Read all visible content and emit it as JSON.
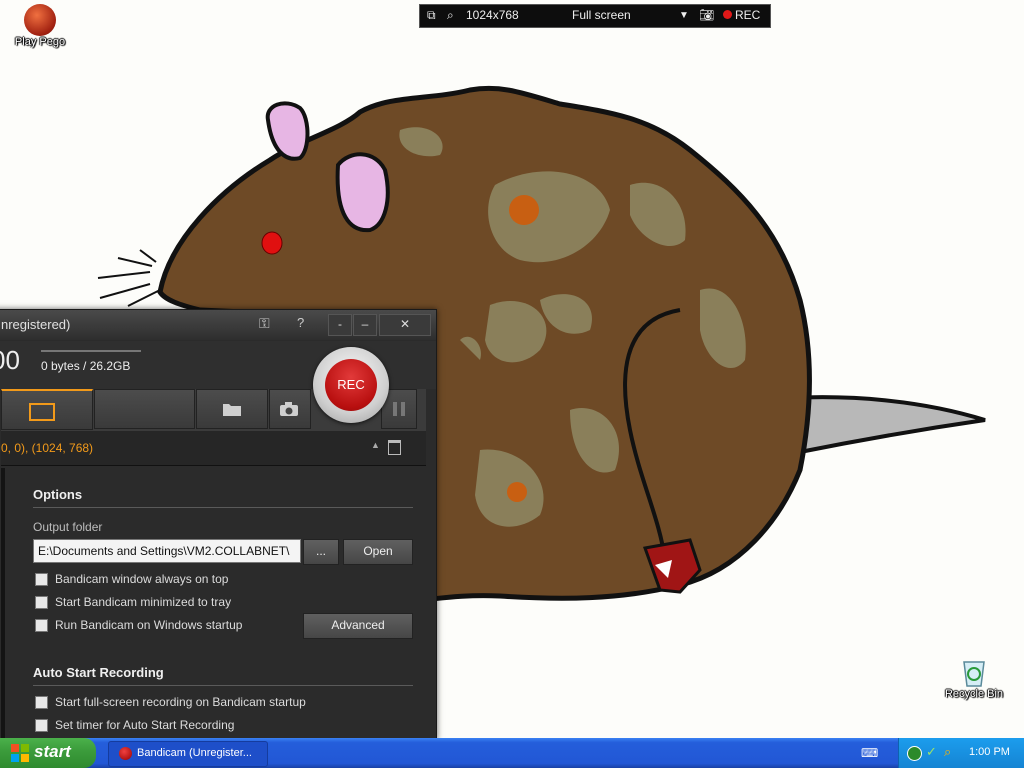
{
  "desktop": {
    "icons": [
      {
        "label": "Play Pego"
      },
      {
        "label": "Recycle Bin"
      }
    ]
  },
  "rec_toolbar": {
    "resolution": "1024x768",
    "mode": "Full screen",
    "rec_label": "REC",
    "icons": [
      "window-icon",
      "zoom-icon",
      "dropdown-icon",
      "camera-icon",
      "record-dot-icon"
    ]
  },
  "bandicam": {
    "title": "nregistered)",
    "timer": "00",
    "file_size": "0 bytes / 26.2GB",
    "rec_button": "REC",
    "region": "0, 0), (1024, 768)",
    "options": {
      "title": "Options",
      "output_folder_label": "Output folder",
      "output_folder_value": "E:\\Documents and Settings\\VM2.COLLABNET\\",
      "browse_label": "...",
      "open_label": "Open",
      "checkboxes": [
        {
          "label": "Bandicam window always on top",
          "checked": false
        },
        {
          "label": "Start Bandicam minimized to tray",
          "checked": false
        },
        {
          "label": "Run Bandicam on Windows startup",
          "checked": false
        }
      ],
      "advanced_label": "Advanced"
    },
    "auto_start": {
      "title": "Auto Start Recording",
      "checkboxes": [
        {
          "label": "Start full-screen recording on Bandicam startup",
          "checked": false
        },
        {
          "label": "Set timer for Auto Start Recording",
          "checked": false
        }
      ]
    },
    "accent_color": "#f29a1a"
  },
  "taskbar": {
    "start_label": "start",
    "task_label": "Bandicam (Unregister...",
    "clock": "1:00 PM"
  }
}
